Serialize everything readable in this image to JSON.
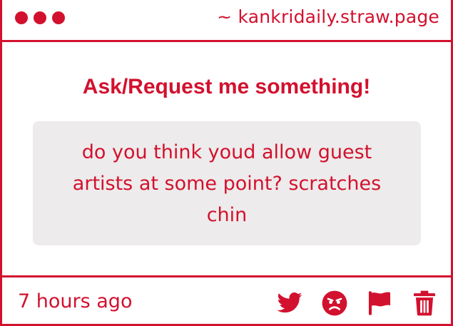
{
  "colors": {
    "accent": "#d2112e",
    "panel": "#edebeb",
    "background": "#ffffff"
  },
  "header": {
    "domain": "~ kankridaily.straw.page",
    "window_dots": [
      "dot",
      "dot",
      "dot"
    ]
  },
  "main": {
    "title": "Ask/Request me something!",
    "question": "do you think youd allow guest artists at some point? scratches chin"
  },
  "footer": {
    "timestamp": "7 hours ago",
    "actions": [
      {
        "name": "twitter-icon",
        "label": "Share on Twitter"
      },
      {
        "name": "angry-face-icon",
        "label": "React"
      },
      {
        "name": "flag-icon",
        "label": "Report"
      },
      {
        "name": "trash-icon",
        "label": "Delete"
      }
    ]
  }
}
